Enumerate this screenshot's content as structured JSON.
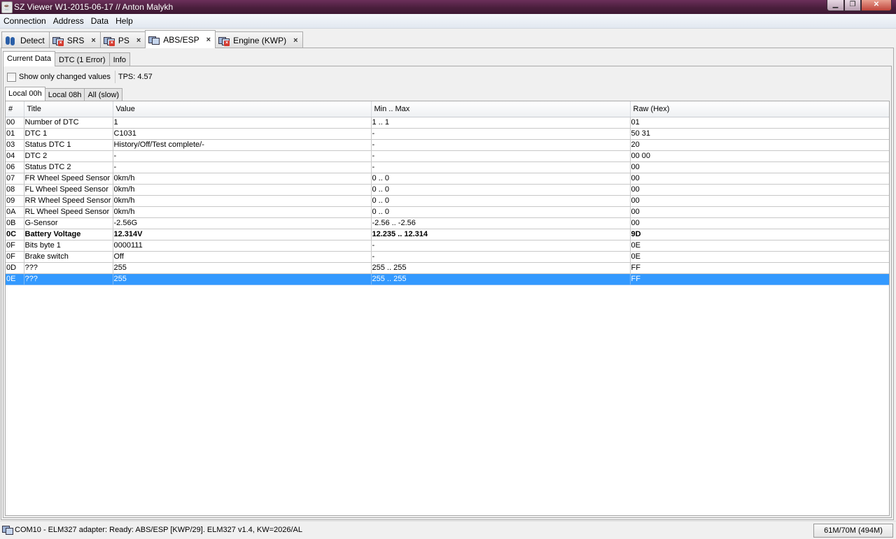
{
  "window": {
    "title": "SZ Viewer W1-2015-06-17 // Anton Malykh"
  },
  "menu": [
    "Connection",
    "Address",
    "Data",
    "Help"
  ],
  "main_tabs": [
    {
      "label": "Detect",
      "icon": "detect-icon",
      "active": false,
      "closable": false
    },
    {
      "label": "SRS",
      "icon": "module-error-icon",
      "active": false,
      "closable": true
    },
    {
      "label": "PS",
      "icon": "module-error-icon",
      "active": false,
      "closable": true
    },
    {
      "label": "ABS/ESP",
      "icon": "module-icon",
      "active": true,
      "closable": true
    },
    {
      "label": "Engine (KWP)",
      "icon": "module-error-icon",
      "active": false,
      "closable": true
    }
  ],
  "sub_tabs": [
    "Current Data",
    "DTC (1 Error)",
    "Info"
  ],
  "options": {
    "show_changed_label": "Show only changed values",
    "show_changed_checked": false,
    "tps": "TPS: 4.57"
  },
  "local_tabs": [
    "Local 00h",
    "Local 08h",
    "All (slow)"
  ],
  "table": {
    "columns": [
      "#",
      "Title",
      "Value",
      "Min .. Max",
      "Raw (Hex)"
    ],
    "rows": [
      [
        "00",
        "Number of DTC",
        "1",
        "1 .. 1",
        "01"
      ],
      [
        "01",
        "DTC 1",
        "C1031",
        "-",
        "50 31"
      ],
      [
        "03",
        "Status DTC 1",
        "History/Off/Test complete/-",
        "-",
        "20"
      ],
      [
        "04",
        "DTC 2",
        "-",
        "-",
        "00 00"
      ],
      [
        "06",
        "Status DTC 2",
        "-",
        "-",
        "00"
      ],
      [
        "07",
        "FR Wheel Speed Sensor",
        "0km/h",
        "0 .. 0",
        "00"
      ],
      [
        "08",
        "FL Wheel Speed Sensor",
        "0km/h",
        "0 .. 0",
        "00"
      ],
      [
        "09",
        "RR Wheel Speed Sensor",
        "0km/h",
        "0 .. 0",
        "00"
      ],
      [
        "0A",
        "RL Wheel Speed Sensor",
        "0km/h",
        "0 .. 0",
        "00"
      ],
      [
        "0B",
        "G-Sensor",
        "-2.56G",
        "-2.56 .. -2.56",
        "00"
      ],
      [
        "0C",
        "Battery Voltage",
        "12.314V",
        "12.235 .. 12.314",
        "9D"
      ],
      [
        "0F",
        "Bits byte 1",
        "0000111",
        "-",
        "0E"
      ],
      [
        "0F",
        "Brake switch",
        "Off",
        "-",
        "0E"
      ],
      [
        "0D",
        "???",
        "255",
        "255 .. 255",
        "FF"
      ],
      [
        "0E",
        "???",
        "255",
        "255 .. 255",
        "FF"
      ]
    ],
    "bold_rows": [
      10
    ],
    "selected_row": 14
  },
  "status": {
    "text": "COM10 - ELM327 adapter: Ready: ABS/ESP [KWP/29]. ELM327 v1.4, KW=2026/AL",
    "memory": "61M/70M (494M)"
  },
  "colors": {
    "title_bar": "#4a1f3d",
    "selection": "#3399ff",
    "error_badge": "#d43a2f"
  }
}
